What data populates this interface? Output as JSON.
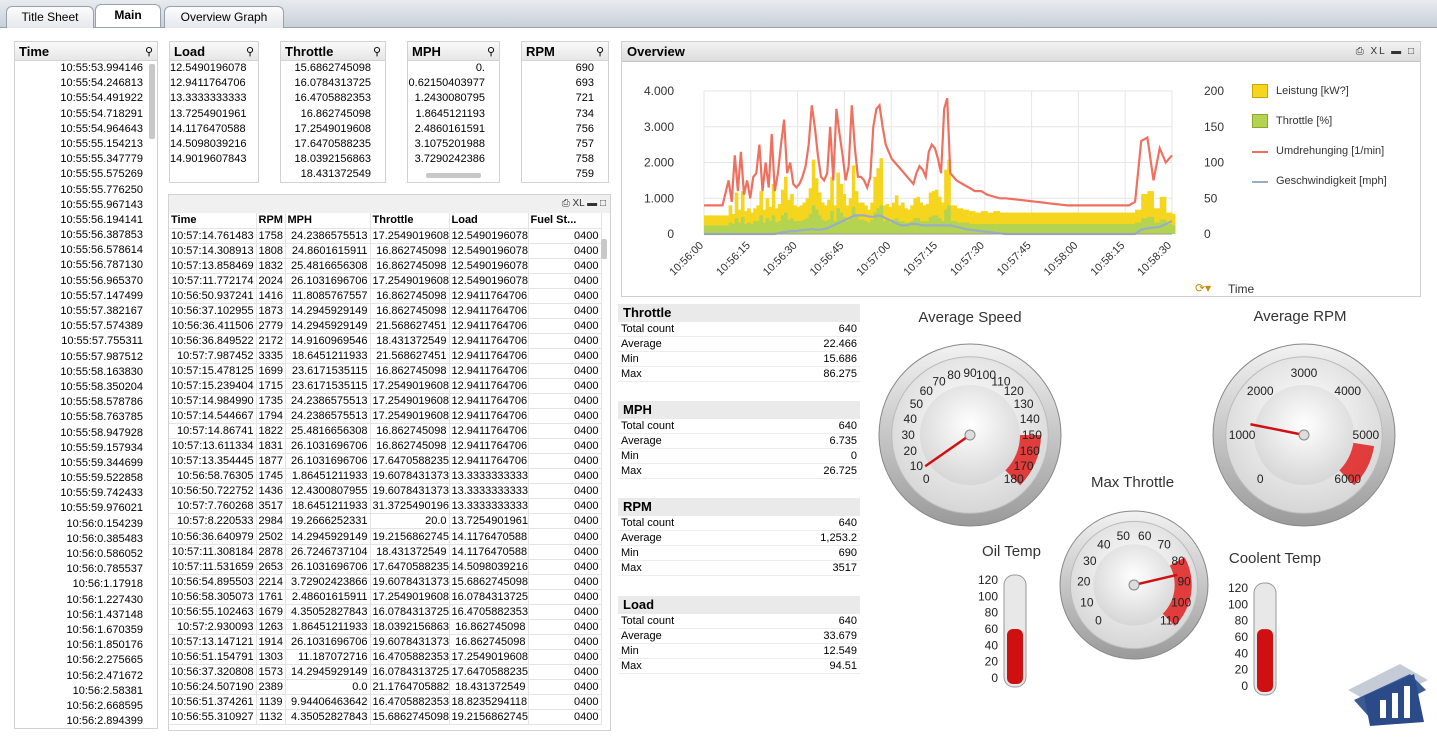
{
  "tabs": [
    "Title Sheet",
    "Main",
    "Overview Graph"
  ],
  "time_list": {
    "title": "Time",
    "values": [
      "10:55:53.994146",
      "10:55:54.246813",
      "10:55:54.491922",
      "10:55:54.718291",
      "10:55:54.964643",
      "10:55:55.154213",
      "10:55:55.347779",
      "10:55:55.575269",
      "10:55:55.776250",
      "10:55:55.967143",
      "10:55:56.194141",
      "10:55:56.387853",
      "10:55:56.578614",
      "10:55:56.787130",
      "10:55:56.965370",
      "10:55:57.147499",
      "10:55:57.382167",
      "10:55:57.574389",
      "10:55:57.755311",
      "10:55:57.987512",
      "10:55:58.163830",
      "10:55:58.350204",
      "10:55:58.578786",
      "10:55:58.763785",
      "10:55:58.947928",
      "10:55:59.157934",
      "10:55:59.344699",
      "10:55:59.522858",
      "10:55:59.742433",
      "10:55:59.976021",
      "10:56:0.154239",
      "10:56:0.385483",
      "10:56:0.586052",
      "10:56:0.785537",
      "10:56:1.17918",
      "10:56:1.227430",
      "10:56:1.437148",
      "10:56:1.670359",
      "10:56:1.850176",
      "10:56:2.275665",
      "10:56:2.471672",
      "10:56:2.58381",
      "10:56:2.668595",
      "10:56:2.894399"
    ]
  },
  "load_list": {
    "title": "Load",
    "values": [
      "12.5490196078",
      "12.9411764706",
      "13.3333333333",
      "13.7254901961",
      "14.1176470588",
      "14.5098039216",
      "14.9019607843"
    ]
  },
  "throttle_list": {
    "title": "Throttle",
    "values": [
      "15.6862745098",
      "16.0784313725",
      "16.4705882353",
      "16.862745098",
      "17.2549019608",
      "17.6470588235",
      "18.0392156863",
      "18.431372549"
    ]
  },
  "mph_list": {
    "title": "MPH",
    "values": [
      "0.",
      "0.62150403977",
      "1.2430080795",
      "1.8645121193",
      "2.4860161591",
      "3.1075201988",
      "3.7290242386"
    ]
  },
  "rpm_list": {
    "title": "RPM",
    "values": [
      "690",
      "693",
      "721",
      "734",
      "756",
      "757",
      "758",
      "759"
    ]
  },
  "table": {
    "headers": [
      "Time",
      "RPM",
      "MPH",
      "Throttle",
      "Load",
      "Fuel St..."
    ],
    "rows": [
      [
        "10:57:14.761483",
        "1758",
        "24.2386575513",
        "17.2549019608",
        "12.5490196078",
        "0400"
      ],
      [
        "10:57:14.308913",
        "1808",
        "24.8601615911",
        "16.862745098",
        "12.5490196078",
        "0400"
      ],
      [
        "10:57:13.858469",
        "1832",
        "25.4816656308",
        "16.862745098",
        "12.5490196078",
        "0400"
      ],
      [
        "10:57:11.772174",
        "2024",
        "26.1031696706",
        "17.2549019608",
        "12.5490196078",
        "0400"
      ],
      [
        "10:56:50.937241",
        "1416",
        "11.8085767557",
        "16.862745098",
        "12.9411764706",
        "0400"
      ],
      [
        "10:56:37.102955",
        "1873",
        "14.2945929149",
        "16.862745098",
        "12.9411764706",
        "0400"
      ],
      [
        "10:56:36.411506",
        "2779",
        "14.2945929149",
        "21.568627451",
        "12.9411764706",
        "0400"
      ],
      [
        "10:56:36.849522",
        "2172",
        "14.9160969546",
        "18.431372549",
        "12.9411764706",
        "0400"
      ],
      [
        "10:57:7.987452",
        "3335",
        "18.6451211933",
        "21.568627451",
        "12.9411764706",
        "0400"
      ],
      [
        "10:57:15.478125",
        "1699",
        "23.6171535115",
        "16.862745098",
        "12.9411764706",
        "0400"
      ],
      [
        "10:57:15.239404",
        "1715",
        "23.6171535115",
        "17.2549019608",
        "12.9411764706",
        "0400"
      ],
      [
        "10:57:14.984990",
        "1735",
        "24.2386575513",
        "17.2549019608",
        "12.9411764706",
        "0400"
      ],
      [
        "10:57:14.544667",
        "1794",
        "24.2386575513",
        "17.2549019608",
        "12.9411764706",
        "0400"
      ],
      [
        "10:57:14.86741",
        "1822",
        "25.4816656308",
        "16.862745098",
        "12.9411764706",
        "0400"
      ],
      [
        "10:57:13.611334",
        "1831",
        "26.1031696706",
        "16.862745098",
        "12.9411764706",
        "0400"
      ],
      [
        "10:57:13.354445",
        "1877",
        "26.1031696706",
        "17.6470588235",
        "12.9411764706",
        "0400"
      ],
      [
        "10:56:58.76305",
        "1745",
        "1.86451211933",
        "19.6078431373",
        "13.3333333333",
        "0400"
      ],
      [
        "10:56:50.722752",
        "1436",
        "12.4300807955",
        "19.6078431373",
        "13.3333333333",
        "0400"
      ],
      [
        "10:57:7.760268",
        "3517",
        "18.6451211933",
        "31.3725490196",
        "13.3333333333",
        "0400"
      ],
      [
        "10:57:8.220533",
        "2984",
        "19.2666252331",
        "20.0",
        "13.7254901961",
        "0400"
      ],
      [
        "10:56:36.640979",
        "2502",
        "14.2945929149",
        "19.2156862745",
        "14.1176470588",
        "0400"
      ],
      [
        "10:57:11.308184",
        "2878",
        "26.7246737104",
        "18.431372549",
        "14.1176470588",
        "0400"
      ],
      [
        "10:57:11.531659",
        "2653",
        "26.1031696706",
        "17.6470588235",
        "14.5098039216",
        "0400"
      ],
      [
        "10:56:54.895503",
        "2214",
        "3.72902423866",
        "19.6078431373",
        "15.6862745098",
        "0400"
      ],
      [
        "10:56:58.305073",
        "1761",
        "2.48601615911",
        "17.2549019608",
        "16.0784313725",
        "0400"
      ],
      [
        "10:56:55.102463",
        "1679",
        "4.35052827843",
        "16.0784313725",
        "16.4705882353",
        "0400"
      ],
      [
        "10:57:2.930093",
        "1263",
        "1.86451211933",
        "18.0392156863",
        "16.862745098",
        "0400"
      ],
      [
        "10:57:13.147121",
        "1914",
        "26.1031696706",
        "19.6078431373",
        "16.862745098",
        "0400"
      ],
      [
        "10:56:51.154791",
        "1303",
        "11.187072716",
        "16.4705882353",
        "17.2549019608",
        "0400"
      ],
      [
        "10:56:37.320808",
        "1573",
        "14.2945929149",
        "16.0784313725",
        "17.6470588235",
        "0400"
      ],
      [
        "10:56:24.507190",
        "2389",
        "0.0",
        "21.1764705882",
        "18.431372549",
        "0400"
      ],
      [
        "10:56:51.374261",
        "1139",
        "9.94406463642",
        "16.4705882353",
        "18.8235294118",
        "0400"
      ],
      [
        "10:56:55.310927",
        "1132",
        "4.35052827843",
        "15.6862745098",
        "19.2156862745",
        "0400"
      ]
    ]
  },
  "overview": {
    "title": "Overview",
    "icons": "XL",
    "dimension_label": "Time",
    "colors": {
      "leistung": "#f5d51e",
      "throttle": "#b4d350",
      "rpm": "#f07060",
      "speed": "#98aec8"
    }
  },
  "chart_data": {
    "type": "area",
    "title": "Overview",
    "xlabel": "Time",
    "x_ticks": [
      "10:56:00",
      "10:56:15",
      "10:56:30",
      "10:56:45",
      "10:57:00",
      "10:57:15",
      "10:57:30",
      "10:57:45",
      "10:58:00",
      "10:58:15",
      "10:58:30"
    ],
    "left_axis": {
      "ticks": [
        "4.000",
        "3.000",
        "2.000",
        "1.000",
        "0"
      ],
      "ylim": [
        0,
        4000
      ]
    },
    "right_axis": {
      "ticks": [
        "200",
        "150",
        "100",
        "50",
        "0"
      ],
      "ylim": [
        0,
        200
      ]
    },
    "x_seconds": [
      0,
      2,
      4,
      6,
      8,
      9,
      10,
      11,
      12,
      13,
      14,
      15,
      16,
      17,
      18,
      19,
      20,
      21,
      22,
      23,
      24,
      25,
      26,
      27,
      28,
      29,
      30,
      31,
      32,
      33,
      34,
      35,
      36,
      37,
      38,
      39,
      40,
      41,
      42,
      43,
      44,
      45,
      46,
      47,
      48,
      49,
      50,
      51,
      52,
      53,
      54,
      55,
      56,
      57,
      58,
      59,
      60,
      61,
      62,
      63,
      64,
      65,
      66,
      67,
      68,
      69,
      70,
      71,
      72,
      73,
      74,
      75,
      76,
      77,
      78,
      79,
      80,
      82,
      84,
      86,
      88,
      90,
      92,
      94,
      96,
      98,
      100,
      102,
      104,
      106,
      108,
      110,
      112,
      114,
      116,
      118,
      120,
      122,
      124,
      126,
      128,
      130,
      132,
      134,
      136,
      138,
      140,
      142,
      144,
      146,
      148,
      150,
      152
    ],
    "series": [
      {
        "name": "Leistung [kW?]",
        "axis": "right",
        "kind": "bar",
        "values": [
          26,
          26,
          26,
          26,
          40,
          28,
          58,
          34,
          60,
          32,
          36,
          30,
          36,
          40,
          60,
          34,
          50,
          38,
          70,
          36,
          42,
          62,
          80,
          48,
          56,
          40,
          38,
          40,
          44,
          50,
          64,
          104,
          78,
          58,
          44,
          40,
          48,
          80,
          40,
          86,
          70,
          56,
          40,
          50,
          96,
          60,
          44,
          44,
          40,
          34,
          44,
          80,
          92,
          106,
          40,
          42,
          38,
          44,
          54,
          40,
          44,
          36,
          34,
          40,
          50,
          52,
          44,
          40,
          42,
          58,
          60,
          62,
          52,
          44,
          90,
          104,
          40,
          36,
          34,
          32,
          30,
          32,
          30,
          32,
          30,
          30,
          30,
          30,
          30,
          30,
          30,
          30,
          30,
          30,
          30,
          30,
          30,
          30,
          30,
          30,
          30,
          30,
          30,
          30,
          30,
          30,
          34,
          56,
          60,
          36,
          52,
          30,
          28
        ]
      },
      {
        "name": "Throttle [%]",
        "axis": "right",
        "kind": "bar",
        "values": [
          12,
          12,
          12,
          12,
          16,
          14,
          22,
          16,
          24,
          14,
          16,
          14,
          18,
          18,
          26,
          16,
          22,
          18,
          26,
          16,
          18,
          26,
          30,
          20,
          22,
          18,
          18,
          18,
          20,
          22,
          28,
          40,
          34,
          26,
          20,
          18,
          20,
          32,
          18,
          36,
          30,
          24,
          18,
          22,
          38,
          26,
          20,
          20,
          18,
          16,
          20,
          30,
          36,
          40,
          18,
          20,
          16,
          20,
          22,
          18,
          18,
          16,
          16,
          18,
          22,
          22,
          18,
          18,
          18,
          24,
          26,
          26,
          22,
          18,
          34,
          40,
          18,
          16,
          16,
          14,
          14,
          14,
          14,
          14,
          14,
          14,
          14,
          14,
          14,
          14,
          14,
          14,
          14,
          14,
          14,
          14,
          14,
          14,
          14,
          14,
          14,
          14,
          14,
          14,
          14,
          14,
          16,
          22,
          24,
          16,
          20,
          14,
          12
        ]
      },
      {
        "name": "Umdrehunging [1/min]",
        "axis": "left",
        "kind": "line",
        "values": [
          800,
          800,
          800,
          800,
          1500,
          900,
          2200,
          1200,
          2300,
          1100,
          1500,
          1000,
          1600,
          1700,
          2500,
          1200,
          2000,
          1300,
          2800,
          1200,
          1700,
          2500,
          3200,
          1700,
          2000,
          1400,
          1300,
          1400,
          1600,
          1900,
          2500,
          3600,
          3000,
          2200,
          1600,
          1500,
          1700,
          3000,
          1500,
          3500,
          2800,
          2200,
          1500,
          1900,
          3600,
          2400,
          1600,
          1600,
          1500,
          1300,
          1600,
          3000,
          3500,
          3600,
          3000,
          2500,
          2300,
          2100,
          2000,
          1900,
          1800,
          1700,
          1600,
          1500,
          1400,
          1700,
          1900,
          1800,
          1600,
          2300,
          2500,
          2400,
          2100,
          1700,
          3500,
          3800,
          1700,
          1500,
          1400,
          1300,
          1200,
          1200,
          1100,
          1050,
          1000,
          1000,
          980,
          960,
          940,
          920,
          900,
          880,
          860,
          840,
          820,
          800,
          800,
          800,
          800,
          800,
          800,
          800,
          800,
          800,
          800,
          800,
          900,
          2600,
          2700,
          1500,
          2400,
          2000,
          2200
        ]
      },
      {
        "name": "Geschwindigkeit [mph]",
        "axis": "right",
        "kind": "line",
        "values": [
          0,
          0,
          0,
          0,
          0,
          0,
          0,
          0,
          0,
          0,
          0,
          0,
          0,
          0,
          0,
          0,
          0,
          0,
          0,
          0,
          1,
          2,
          3,
          3,
          4,
          4,
          4,
          5,
          5,
          6,
          6,
          7,
          6,
          6,
          6,
          7,
          8,
          10,
          12,
          14,
          16,
          18,
          20,
          22,
          24,
          26,
          26,
          26,
          26,
          25,
          24,
          24,
          25,
          26,
          24,
          22,
          20,
          18,
          16,
          14,
          12,
          12,
          12,
          14,
          14,
          14,
          13,
          12,
          12,
          12,
          12,
          12,
          12,
          12,
          12,
          12,
          12,
          10,
          8,
          6,
          5,
          4,
          3,
          2,
          1,
          0,
          0,
          0,
          0,
          0,
          0,
          0,
          0,
          0,
          0,
          0,
          0,
          0,
          0,
          0,
          0,
          0,
          0,
          0,
          0,
          0,
          0,
          6,
          8,
          9,
          10,
          14,
          18
        ]
      }
    ]
  },
  "stats": [
    {
      "title": "Throttle",
      "rows": [
        [
          "Total count",
          "640"
        ],
        [
          "Average",
          "22.466"
        ],
        [
          "Min",
          "15.686"
        ],
        [
          "Max",
          "86.275"
        ]
      ]
    },
    {
      "title": "MPH",
      "rows": [
        [
          "Total count",
          "640"
        ],
        [
          "Average",
          "6.735"
        ],
        [
          "Min",
          "0"
        ],
        [
          "Max",
          "26.725"
        ]
      ]
    },
    {
      "title": "RPM",
      "rows": [
        [
          "Total count",
          "640"
        ],
        [
          "Average",
          "1,253.2"
        ],
        [
          "Min",
          "690"
        ],
        [
          "Max",
          "3517"
        ]
      ]
    },
    {
      "title": "Load",
      "rows": [
        [
          "Total count",
          "640"
        ],
        [
          "Average",
          "33.679"
        ],
        [
          "Min",
          "12.549"
        ],
        [
          "Max",
          "94.51"
        ]
      ]
    }
  ],
  "gauges": {
    "avg_speed": {
      "title": "Average Speed",
      "labels": [
        "0",
        "10",
        "20",
        "30",
        "40",
        "50",
        "60",
        "70",
        "80",
        "90",
        "100",
        "110",
        "120",
        "130",
        "140",
        "150",
        "160",
        "170",
        "180"
      ],
      "value": 6.735,
      "max": 180,
      "red_from": 150
    },
    "avg_rpm": {
      "title": "Average RPM",
      "labels": [
        "0",
        "1000",
        "2000",
        "3000",
        "4000",
        "5000",
        "6000"
      ],
      "value": 1253.2,
      "max": 6000,
      "red_from": 5200
    },
    "max_throttle": {
      "title": "Max Throttle",
      "labels": [
        "0",
        "10",
        "20",
        "30",
        "40",
        "50",
        "60",
        "70",
        "80",
        "90",
        "100",
        "110"
      ],
      "value": 86.275,
      "max": 110,
      "red_from": 80
    },
    "oil_temp": {
      "title": "Oil Temp",
      "labels": [
        "120",
        "100",
        "80",
        "60",
        "40",
        "20",
        "0"
      ],
      "fill": 0.5
    },
    "coolent_temp": {
      "title": "Coolent Temp",
      "labels": [
        "120",
        "100",
        "80",
        "60",
        "40",
        "20",
        "0"
      ],
      "fill": 0.58
    }
  }
}
